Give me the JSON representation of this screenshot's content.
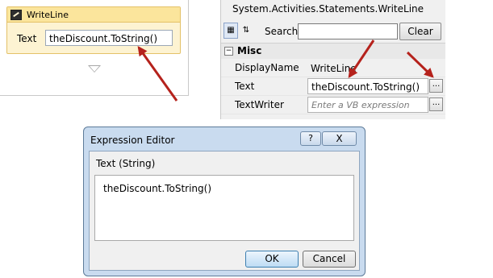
{
  "designer": {
    "activity_title": "WriteLine",
    "text_label": "Text",
    "text_value": "theDiscount.ToString()"
  },
  "properties": {
    "title": "System.Activities.Statements.WriteLine",
    "search_label": "Search:",
    "search_value": "",
    "clear_label": "Clear",
    "category": "Misc",
    "rows": [
      {
        "name": "DisplayName",
        "value": "WriteLine"
      },
      {
        "name": "Text",
        "value": "theDiscount.ToString()",
        "button": "..."
      },
      {
        "name": "TextWriter",
        "value": "Enter a VB expression",
        "button": "..."
      }
    ]
  },
  "dialog": {
    "title": "Expression Editor",
    "help_glyph": "?",
    "close_glyph": "X",
    "type_label": "Text (String)",
    "expression": "theDiscount.ToString()",
    "ok_label": "OK",
    "cancel_label": "Cancel"
  },
  "colors": {
    "arrow": "#b5221c",
    "activity_header": "#fbe59c",
    "dialog_frame": "#c9dbef"
  }
}
